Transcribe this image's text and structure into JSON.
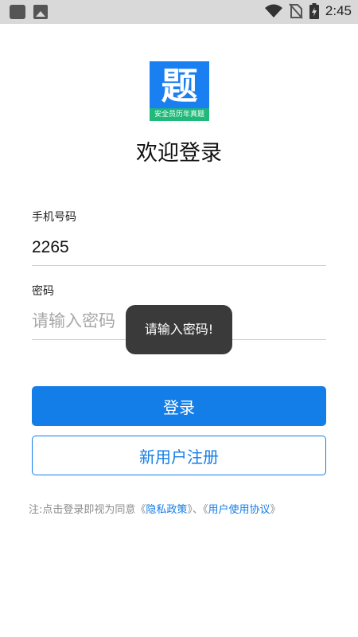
{
  "status_bar": {
    "time": "2:45",
    "icons": [
      "notification-square-icon",
      "image-icon",
      "wifi-icon",
      "no-sim-icon",
      "battery-charging-icon"
    ]
  },
  "logo": {
    "char": "题",
    "caption": "安全员历年真题",
    "bg_color": "#1a7ff0",
    "strip_color": "#1fb97a"
  },
  "page": {
    "title": "欢迎登录"
  },
  "phone": {
    "label": "手机号码",
    "value": "2265",
    "placeholder": ""
  },
  "password": {
    "label": "密码",
    "value": "",
    "placeholder": "请输入密码"
  },
  "toast": {
    "message": "请输入密码!"
  },
  "buttons": {
    "login": "登录",
    "register": "新用户注册"
  },
  "footer": {
    "prefix": "注:点击登录即视为同意",
    "quote_open_1": "《",
    "privacy": "隐私政策",
    "quote_close_1": "》",
    "separator": "、",
    "quote_open_2": "《",
    "agreement": "用户使用协议",
    "quote_close_2": "》"
  },
  "colors": {
    "accent": "#137de8",
    "toast_bg": "#3a3a3a",
    "status_bar_bg": "#d9d9d9"
  }
}
